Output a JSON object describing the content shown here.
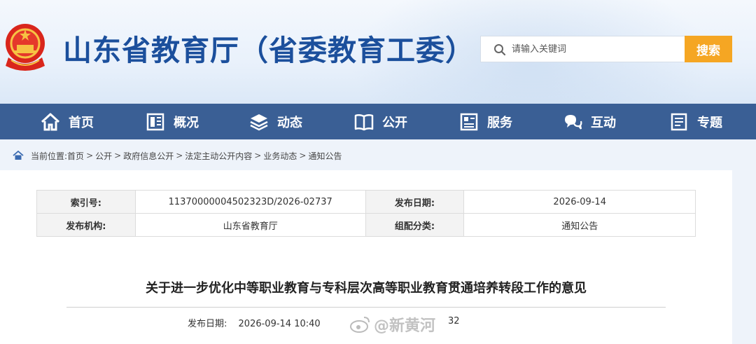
{
  "header": {
    "site_title": "山东省教育厅（省委教育工委）",
    "search": {
      "placeholder": "请输入关键词",
      "button_label": "搜索"
    }
  },
  "nav": {
    "items": [
      {
        "label": "首页",
        "icon": "home-icon"
      },
      {
        "label": "概况",
        "icon": "overview-icon"
      },
      {
        "label": "动态",
        "icon": "stack-icon"
      },
      {
        "label": "公开",
        "icon": "book-icon"
      },
      {
        "label": "服务",
        "icon": "service-icon"
      },
      {
        "label": "互动",
        "icon": "chat-icon"
      },
      {
        "label": "专题",
        "icon": "topic-icon"
      }
    ]
  },
  "breadcrumb": {
    "prefix": "当前位置:",
    "items": [
      "首页",
      "公开",
      "政府信息公开",
      "法定主动公开内容",
      "业务动态",
      "通知公告"
    ],
    "separator": ">"
  },
  "meta": {
    "index_label": "索引号:",
    "index_value": "11370000004502323D/2026-02737",
    "date_label": "发布日期:",
    "date_value": "2026-09-14",
    "org_label": "发布机构:",
    "org_value": "山东省教育厅",
    "category_label": "组配分类:",
    "category_value": "通知公告"
  },
  "article": {
    "title": "关于进一步优化中等职业教育与专科层次高等职业教育贯通培养转段工作的意见",
    "published_label": "发布日期:",
    "published_value": "2026-09-14 10:40",
    "views": "32"
  },
  "watermark": {
    "text": "@新黄河"
  },
  "colors": {
    "nav_bg": "#3a5f95",
    "title_blue": "#1b4f9c",
    "search_button": "#f5a623"
  }
}
